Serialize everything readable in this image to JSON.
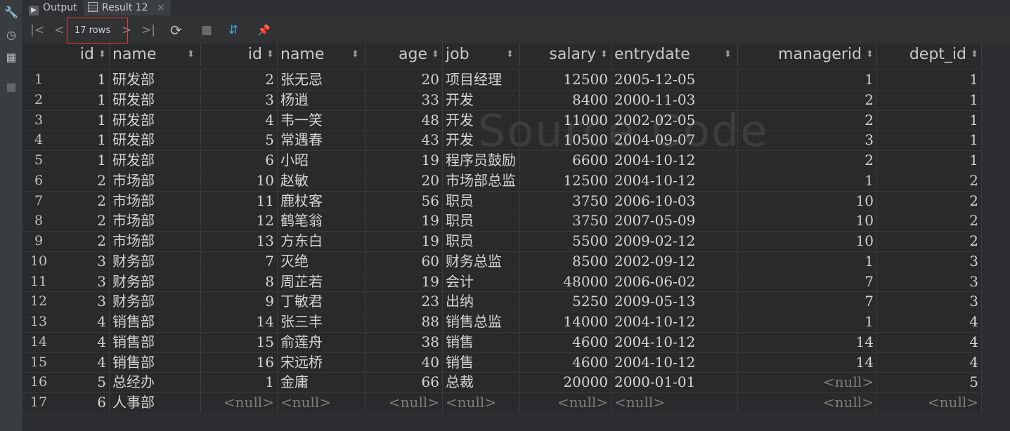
{
  "tabs": [
    {
      "label": "Output",
      "icon": "terminal-icon"
    },
    {
      "label": "Result 12",
      "icon": "table-icon",
      "close": "×"
    }
  ],
  "toolbar": {
    "rows_label": "17 rows",
    "first_icon": "|<",
    "prev_icon": "<",
    "next_icon": ">",
    "last_icon": ">|",
    "refresh_icon": "⟳",
    "stop_icon": "■",
    "compare_icon": "⇵",
    "pin_icon": "📌"
  },
  "columns": [
    {
      "name": "id",
      "align": "r"
    },
    {
      "name": "name",
      "align": "l"
    },
    {
      "name": "id",
      "align": "r"
    },
    {
      "name": "name",
      "align": "l"
    },
    {
      "name": "age",
      "align": "r"
    },
    {
      "name": "job",
      "align": "l"
    },
    {
      "name": "salary",
      "align": "r"
    },
    {
      "name": "entrydate",
      "align": "l"
    },
    {
      "name": "managerid",
      "align": "r"
    },
    {
      "name": "dept_id",
      "align": "r"
    }
  ],
  "sort_icon": "⬍",
  "rows": [
    [
      "1",
      "研发部",
      "2",
      "张无忌",
      "20",
      "项目经理",
      "12500",
      "2005-12-05",
      "1",
      "1"
    ],
    [
      "1",
      "研发部",
      "3",
      "杨逍",
      "33",
      "开发",
      "8400",
      "2000-11-03",
      "2",
      "1"
    ],
    [
      "1",
      "研发部",
      "4",
      "韦一笑",
      "48",
      "开发",
      "11000",
      "2002-02-05",
      "2",
      "1"
    ],
    [
      "1",
      "研发部",
      "5",
      "常遇春",
      "43",
      "开发",
      "10500",
      "2004-09-07",
      "3",
      "1"
    ],
    [
      "1",
      "研发部",
      "6",
      "小昭",
      "19",
      "程序员鼓励",
      "6600",
      "2004-10-12",
      "2",
      "1"
    ],
    [
      "2",
      "市场部",
      "10",
      "赵敏",
      "20",
      "市场部总监",
      "12500",
      "2004-10-12",
      "1",
      "2"
    ],
    [
      "2",
      "市场部",
      "11",
      "鹿杖客",
      "56",
      "职员",
      "3750",
      "2006-10-03",
      "10",
      "2"
    ],
    [
      "2",
      "市场部",
      "12",
      "鹤笔翁",
      "19",
      "职员",
      "3750",
      "2007-05-09",
      "10",
      "2"
    ],
    [
      "2",
      "市场部",
      "13",
      "方东白",
      "19",
      "职员",
      "5500",
      "2009-02-12",
      "10",
      "2"
    ],
    [
      "3",
      "财务部",
      "7",
      "灭绝",
      "60",
      "财务总监",
      "8500",
      "2002-09-12",
      "1",
      "3"
    ],
    [
      "3",
      "财务部",
      "8",
      "周芷若",
      "19",
      "会计",
      "48000",
      "2006-06-02",
      "7",
      "3"
    ],
    [
      "3",
      "财务部",
      "9",
      "丁敏君",
      "23",
      "出纳",
      "5250",
      "2009-05-13",
      "7",
      "3"
    ],
    [
      "4",
      "销售部",
      "14",
      "张三丰",
      "88",
      "销售总监",
      "14000",
      "2004-10-12",
      "1",
      "4"
    ],
    [
      "4",
      "销售部",
      "15",
      "俞莲舟",
      "38",
      "销售",
      "4600",
      "2004-10-12",
      "14",
      "4"
    ],
    [
      "4",
      "销售部",
      "16",
      "宋远桥",
      "40",
      "销售",
      "4600",
      "2004-10-12",
      "14",
      "4"
    ],
    [
      "5",
      "总经办",
      "1",
      "金庸",
      "66",
      "总裁",
      "20000",
      "2000-01-01",
      "<null>",
      "5"
    ],
    [
      "6",
      "人事部",
      "<null>",
      "<null>",
      "<null>",
      "<null>",
      "<null>",
      "<null>",
      "<null>",
      "<null>"
    ]
  ],
  "watermark": "Source Code"
}
